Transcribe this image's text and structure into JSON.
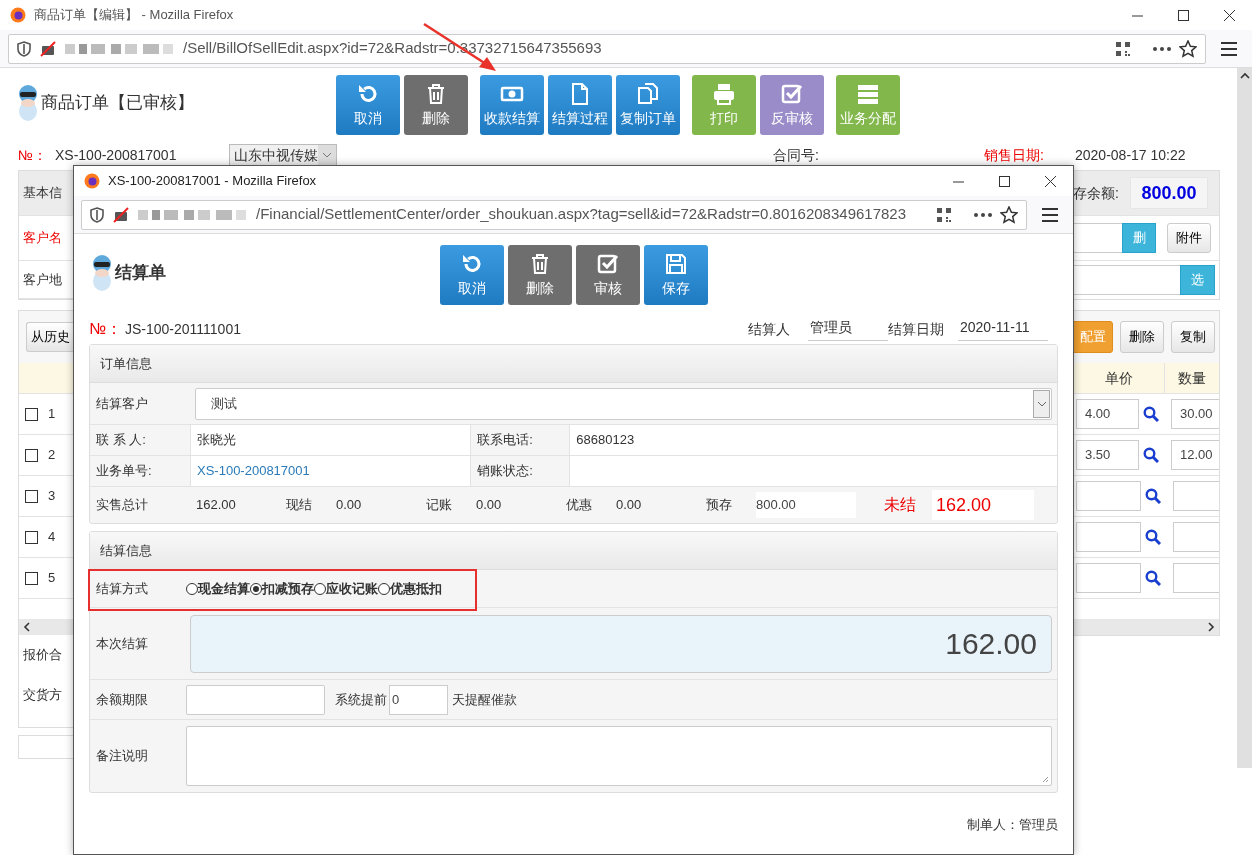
{
  "back_window": {
    "title": "商品订单【编辑】 - Mozilla Firefox",
    "url": "/Sell/BillOfSellEdit.aspx?id=72&Radstr=0.33732715647355693",
    "page_title": "商品订单【已审核】",
    "toolbar_groups": [
      [
        {
          "label": "取消",
          "kind": "undo"
        },
        {
          "label": "删除",
          "kind": "trash"
        }
      ],
      [
        {
          "label": "收款结算",
          "kind": "money"
        },
        {
          "label": "结算过程",
          "kind": "document"
        },
        {
          "label": "复制订单",
          "kind": "copy"
        }
      ],
      [
        {
          "label": "打印",
          "kind": "print"
        },
        {
          "label": "反审核",
          "kind": "check"
        }
      ],
      [
        {
          "label": "业务分配",
          "kind": "list"
        }
      ]
    ],
    "number_label": "№：",
    "number": "XS-100-200817001",
    "company": "山东中视传媒",
    "contract_label": "合同号:",
    "date_label": "销售日期:",
    "date": "2020-08-17 10:22",
    "info_rows": [
      {
        "label": "基本信",
        "required": false
      },
      {
        "label": "客户名",
        "required": true
      },
      {
        "label": "客户地",
        "required": false
      }
    ],
    "prepaid_label": "存余额:",
    "prepaid_value": "800.00",
    "delete_button": "删",
    "attach_button": "附件",
    "select_button": "选",
    "history_button": "从历史",
    "grid_buttons": [
      "配置",
      "删除",
      "复制"
    ],
    "columns": [
      "单价",
      "数量"
    ],
    "rows": [
      {
        "no": "1",
        "checked": false,
        "price": "4.00",
        "quantity": "30.00"
      },
      {
        "no": "2",
        "checked": false,
        "price": "3.50",
        "quantity": "12.00"
      },
      {
        "no": "3",
        "checked": false
      },
      {
        "no": "4",
        "checked": false
      },
      {
        "no": "5",
        "checked": false
      }
    ],
    "footer_labels": [
      "报价合",
      "交货方"
    ]
  },
  "popup": {
    "title": "XS-100-200817001 - Mozilla Firefox",
    "url": "/Financial/SettlementCenter/order_shoukuan.aspx?tag=sell&id=72&Radstr=0.8016208349617823",
    "page_title": "结算单",
    "toolbar": [
      {
        "label": "取消",
        "kind": "undo"
      },
      {
        "label": "删除",
        "kind": "trash"
      },
      {
        "label": "审核",
        "kind": "check"
      },
      {
        "label": "保存",
        "kind": "save"
      }
    ],
    "number_label": "№：",
    "number": "JS-100-201111001",
    "settler_label": "结算人",
    "settler": "管理员",
    "date_label": "结算日期",
    "date": "2020-11-11",
    "order_info": {
      "title": "订单信息",
      "customer_label": "结算客户",
      "customer": "测试",
      "fields": [
        {
          "label": "联 系 人:",
          "value": "张晓光",
          "kind": "text"
        },
        {
          "label": "联系电话:",
          "value": "68680123",
          "kind": "text"
        },
        {
          "label": "业务单号:",
          "value": "XS-100-200817001",
          "kind": "link"
        },
        {
          "label": "销账状态:",
          "kind": "text"
        }
      ],
      "totals": [
        {
          "label": "实售总计",
          "value": "162.00",
          "kind": "text"
        },
        {
          "label": "现结",
          "value": "0.00",
          "kind": "text"
        },
        {
          "label": "记账",
          "value": "0.00",
          "kind": "text"
        },
        {
          "label": "优惠",
          "value": "0.00",
          "kind": "text"
        },
        {
          "label": "预存",
          "value": "800.00",
          "kind": "input"
        }
      ],
      "unsettled_label": "未结",
      "unsettled": "162.00"
    },
    "settlement": {
      "title": "结算信息",
      "method_label": "结算方式",
      "methods": [
        {
          "label": "现金结算",
          "selected": false
        },
        {
          "label": "扣减预存",
          "selected": true
        },
        {
          "label": "应收记账",
          "selected": false
        },
        {
          "label": "优惠抵扣",
          "selected": false
        }
      ],
      "amount_label": "本次结算",
      "amount": "162.00",
      "term_label": "余额期限",
      "advance_label": "系统提前",
      "advance_days": "0",
      "remind_label": "天提醒催款",
      "note_label": "备注说明"
    },
    "creator_label": "制单人：",
    "creator": "管理员"
  }
}
